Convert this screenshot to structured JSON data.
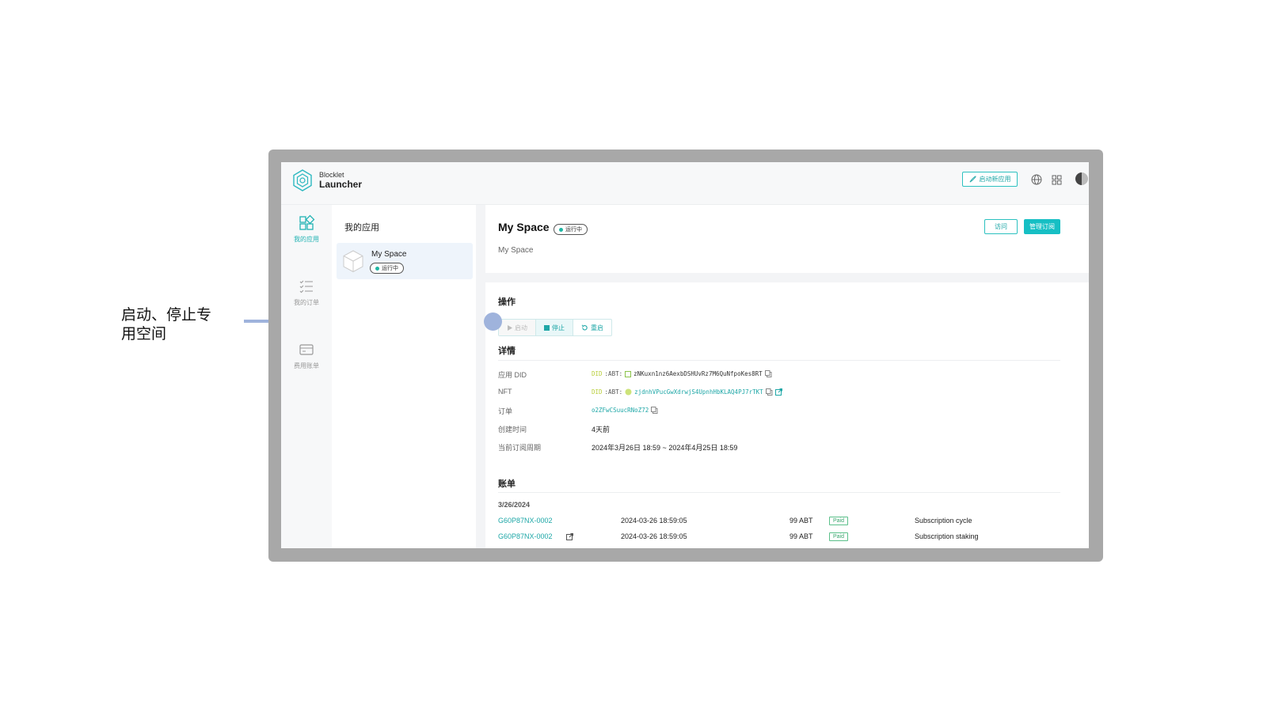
{
  "annotation": {
    "text": "启动、停止专用空间"
  },
  "header": {
    "brand_top": "Blocklet",
    "brand_main": "Launcher",
    "launch_button": "启动新应用",
    "icons": [
      "globe-icon",
      "apps-grid-icon",
      "avatar"
    ]
  },
  "nav": {
    "items": [
      {
        "label": "我的应用",
        "icon": "apps-icon",
        "active": true
      },
      {
        "label": "我的订单",
        "icon": "list-icon",
        "active": false
      },
      {
        "label": "费用账单",
        "icon": "card-icon",
        "active": false
      }
    ]
  },
  "applist": {
    "title": "我的应用",
    "app": {
      "name": "My Space",
      "status": "运行中"
    }
  },
  "main": {
    "title": "My Space",
    "status": "运行中",
    "subtitle": "My Space",
    "visit_button": "访问",
    "manage_button": "管理订阅",
    "ops_title": "操作",
    "ops": {
      "start": "启动",
      "stop": "停止",
      "restart": "重启"
    },
    "details_title": "详情",
    "details": {
      "app_did_label": "应用 DID",
      "app_did_prefix": "DID",
      "app_did_abt": ":ABT:",
      "app_did_value": "zNKuxn1nz6AexbDSHUvRz7M6QuNfpoKes8RT",
      "nft_label": "NFT",
      "nft_prefix": "DID",
      "nft_abt": ":ABT:",
      "nft_value": "zjdnhVPucGwXdrwjS4UpnhHbKLAQ4PJ7rTKT",
      "order_label": "订单",
      "order_value": "o2ZFwCSuucRNoZ72",
      "created_label": "创建时间",
      "created_value": "4天前",
      "period_label": "当前订阅周期",
      "period_value": "2024年3月26日 18:59 ~ 2024年4月25日 18:59"
    },
    "bills_title": "账单",
    "bills_date": "3/26/2024",
    "bills": [
      {
        "id": "G60P87NX-0002",
        "time": "2024-03-26 18:59:05",
        "amount": "99 ABT",
        "status": "Paid",
        "desc": "Subscription cycle"
      },
      {
        "id": "G60P87NX-0002",
        "time": "2024-03-26 18:59:05",
        "amount": "99 ABT",
        "status": "Paid",
        "desc": "Subscription staking"
      }
    ]
  },
  "colors": {
    "accent": "#16bfc4",
    "annotation": "#9fb3dc",
    "paid": "#3aa56e"
  }
}
